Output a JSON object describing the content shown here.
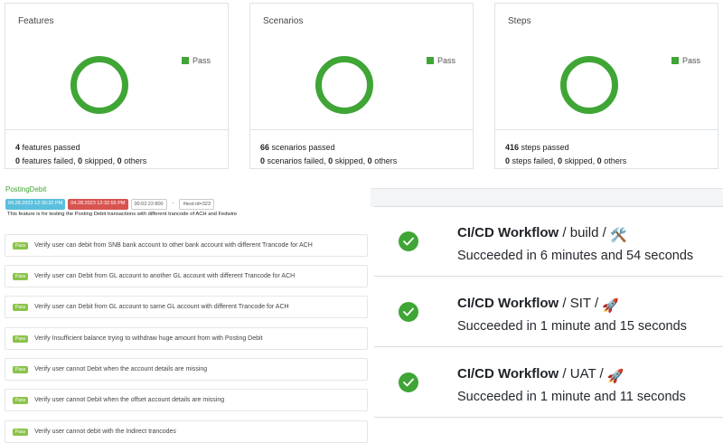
{
  "summary": {
    "features": {
      "title": "Features",
      "legend": "Pass",
      "passed_count": "4",
      "passed_text": "features passed",
      "failed_count": "0",
      "failed_text": "features failed,",
      "skipped_count": "0",
      "skipped_text": "skipped,",
      "others_count": "0",
      "others_text": "others",
      "pass_fraction": 1.0
    },
    "scenarios": {
      "title": "Scenarios",
      "legend": "Pass",
      "passed_count": "66",
      "passed_text": "scenarios passed",
      "failed_count": "0",
      "failed_text": "scenarios failed,",
      "skipped_count": "0",
      "skipped_text": "skipped,",
      "others_count": "0",
      "others_text": "others",
      "pass_fraction": 1.0
    },
    "steps": {
      "title": "Steps",
      "legend": "Pass",
      "passed_count": "416",
      "passed_text": "steps passed",
      "failed_count": "0",
      "failed_text": "steps failed,",
      "skipped_count": "0",
      "skipped_text": "skipped,",
      "others_count": "0",
      "others_text": "others",
      "pass_fraction": 1.0
    },
    "pass_color": "#3fa535"
  },
  "feature": {
    "name": "PostingDebit",
    "start_time": "04.28.2023 12:30:32 PM",
    "end_time": "04.28.2023 12:32:55 PM",
    "duration": "00:02:22:800",
    "separator": "-",
    "tag": "#test-id=323",
    "description": "This feature is for testing the Posting Debit transactions with different trancode of ACH and Fedwire",
    "pass_label": "Pass",
    "scenarios": [
      "Verify user can debit from SNB bank account to other bank account with different Trancode for ACH",
      "Verify user can Debit from GL account to another GL account with different Trancode for ACH",
      "Verify user can Debit from GL account to same GL account with different Trancode for ACH",
      "Verify Insufficient balance trying to withdraw huge amount from with Posting Debit",
      "Verify user cannot Debit when the account details are missing",
      "Verify user cannot Debit when the offset account details are missing",
      "Verify user cannot debit with the Indirect trancodes"
    ]
  },
  "workflows": [
    {
      "name": "CI/CD Workflow",
      "job": "build",
      "emoji": "🛠️",
      "status": "Succeeded in 6 minutes and 54 seconds"
    },
    {
      "name": "CI/CD Workflow",
      "job": "SIT",
      "emoji": "🚀",
      "status": "Succeeded in 1 minute and 15 seconds"
    },
    {
      "name": "CI/CD Workflow",
      "job": "UAT",
      "emoji": "🚀",
      "status": "Succeeded in 1 minute and 11 seconds"
    }
  ],
  "icons": {
    "workflow_status": "check-circle-icon"
  }
}
